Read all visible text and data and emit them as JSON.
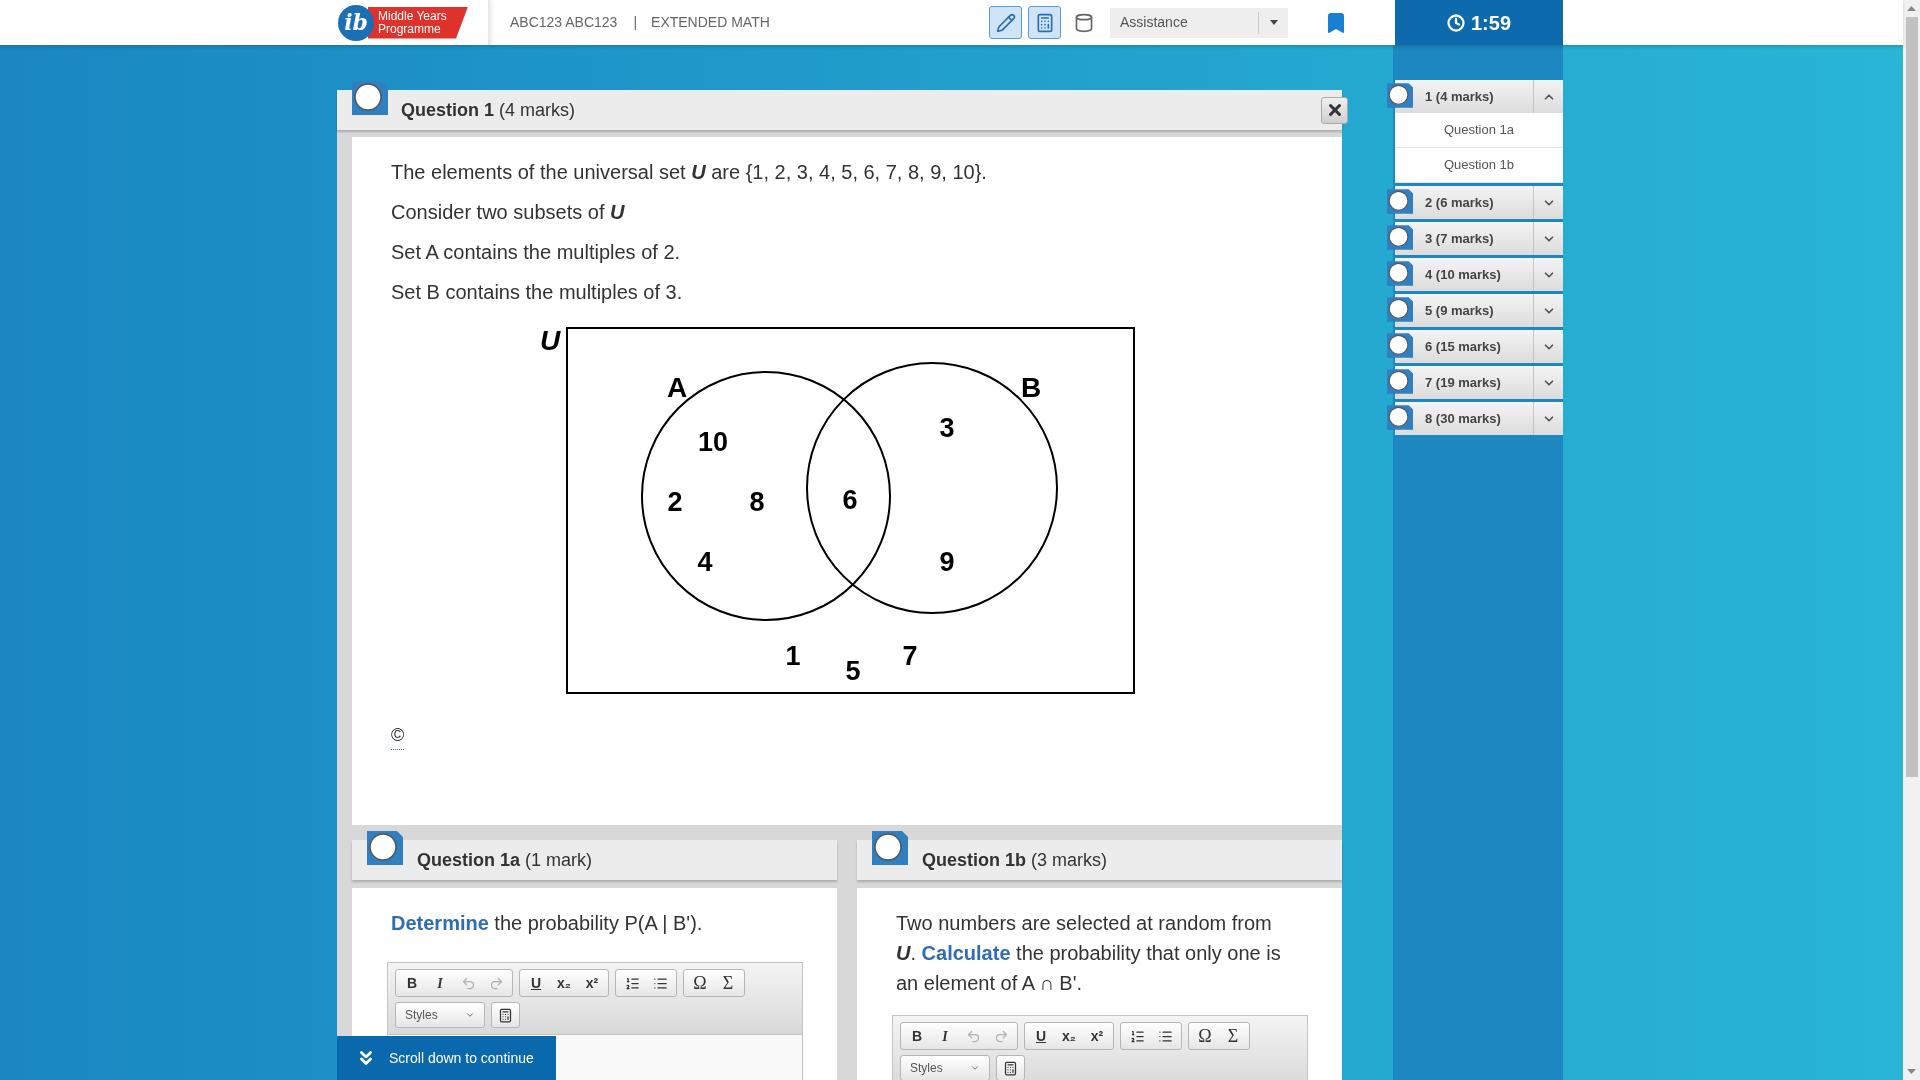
{
  "header": {
    "logo": {
      "mark": "ib",
      "text": "Middle Years Programme"
    },
    "candidate": "ABC123 ABC123",
    "separator": "|",
    "exam": "EXTENDED MATH",
    "tools": [
      {
        "kind": "pen",
        "active": true
      },
      {
        "kind": "calculator",
        "active": true
      },
      {
        "kind": "cylinder",
        "active": false
      }
    ],
    "assistance": {
      "value": "Assistance"
    },
    "timer": "1:59"
  },
  "question": {
    "title": "**Question 1** (4 marks)",
    "flagged": false,
    "paragraphs": [
      "The elements of the universal set *U* are {1, 2, 3, 4, 5, 6, 7, 8, 9, 10}.",
      "Consider two subsets of *U*",
      "Set A contains the multiples of 2.",
      "Set B contains the multiples of 3."
    ],
    "venn": {
      "universe": "U",
      "sets": [
        "A",
        "B"
      ],
      "only_first": [
        "10",
        "2",
        "8",
        "4"
      ],
      "both": [
        "6"
      ],
      "only_second": [
        "3",
        "9"
      ],
      "outside": [
        "1",
        "5",
        "7"
      ]
    },
    "copyright": "©"
  },
  "parts": [
    {
      "title": "**Question 1a** (1 mark)",
      "flagged": false,
      "prompt": "**Determine** the probability P(A | B').",
      "toolbar": [
        [
          {
            "kind": "bold",
            "label": "B",
            "disabled": false
          },
          {
            "kind": "italic",
            "label": "I",
            "disabled": false
          },
          {
            "kind": "undo",
            "disabled": true
          },
          {
            "kind": "redo",
            "disabled": true
          }
        ],
        [
          {
            "kind": "underline",
            "label": "U",
            "disabled": false
          },
          {
            "kind": "subscript",
            "label": "x₂",
            "disabled": false
          },
          {
            "kind": "superscript",
            "label": "x²",
            "disabled": false
          }
        ],
        [
          {
            "kind": "ordered",
            "disabled": false
          },
          {
            "kind": "bullets",
            "disabled": false
          }
        ],
        [
          {
            "kind": "omega",
            "label": "Ω",
            "disabled": false
          },
          {
            "kind": "sigma",
            "label": "Σ",
            "disabled": false
          }
        ]
      ],
      "styles_dropdown": "Styles"
    },
    {
      "title": "**Question 1b** (3 marks)",
      "flagged": false,
      "prompt": "Two numbers are selected at random from *U*. **Calculate** the probability that only one is an element of A ∩ B'.",
      "toolbar": [
        [
          {
            "kind": "bold",
            "label": "B",
            "disabled": false
          },
          {
            "kind": "italic",
            "label": "I",
            "disabled": false
          },
          {
            "kind": "undo",
            "disabled": true
          },
          {
            "kind": "redo",
            "disabled": true
          }
        ],
        [
          {
            "kind": "underline",
            "label": "U",
            "disabled": false
          },
          {
            "kind": "subscript",
            "label": "x₂",
            "disabled": false
          },
          {
            "kind": "superscript",
            "label": "x²",
            "disabled": false
          }
        ],
        [
          {
            "kind": "ordered",
            "disabled": false
          },
          {
            "kind": "bullets",
            "disabled": false
          }
        ],
        [
          {
            "kind": "omega",
            "label": "Ω",
            "disabled": false
          },
          {
            "kind": "sigma",
            "label": "Σ",
            "disabled": false
          }
        ]
      ],
      "styles_dropdown": "Styles"
    }
  ],
  "scroll_hint": "Scroll down to continue",
  "sidebar": [
    {
      "label": "1 (4 marks)",
      "flagged": false,
      "expanded": true,
      "children": [
        {
          "label": "Question 1a"
        },
        {
          "label": "Question 1b"
        }
      ]
    },
    {
      "label": "2 (6 marks)",
      "flagged": false,
      "expanded": false
    },
    {
      "label": "3 (7 marks)",
      "flagged": false,
      "expanded": false
    },
    {
      "label": "4 (10 marks)",
      "flagged": false,
      "expanded": false
    },
    {
      "label": "5 (9 marks)",
      "flagged": false,
      "expanded": false
    },
    {
      "label": "6 (15 marks)",
      "flagged": false,
      "expanded": false
    },
    {
      "label": "7 (19 marks)",
      "flagged": false,
      "expanded": false
    },
    {
      "label": "8 (30 marks)",
      "flagged": false,
      "expanded": false
    }
  ]
}
